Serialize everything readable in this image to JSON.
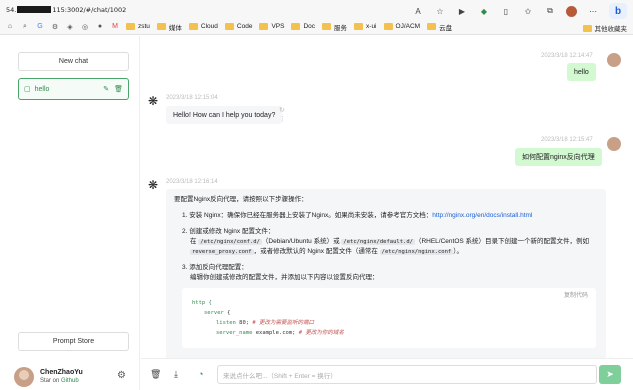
{
  "browser": {
    "url_prefix": "54.",
    "url_suffix": "115:3002/#/chat/1002",
    "bookmarks": [
      "zstu",
      "媒体",
      "Cloud",
      "Code",
      "VPS",
      "Doc",
      "服务",
      "x-ui",
      "OJ/ACM",
      "云盘"
    ],
    "other_bookmarks": "其他收藏夹"
  },
  "sidebar": {
    "new_chat": "New chat",
    "chat_items": [
      {
        "title": "hello"
      }
    ],
    "prompt_store": "Prompt Store",
    "user": {
      "name": "ChenZhaoYu",
      "sub_prefix": "Star on ",
      "sub_link": "Github"
    }
  },
  "messages": {
    "m1_time": "2023/3/18 12:14:47",
    "m1_text": "hello",
    "m2_time": "2023/3/18 12:15:04",
    "m2_text": "Hello! How can I help you today?",
    "m3_time": "2023/3/18 12:15:47",
    "m3_text": "如何配置nginx反向代理",
    "m4_time": "2023/3/18 12:16:14",
    "answer": {
      "intro": "要配置Nginx反向代理，请按照以下步骤操作：",
      "step1_a": "1. 安装 Nginx：确保你已经在服务器上安装了Nginx。如果尚未安装，请参考官方文档：",
      "step1_link": "http://nginx.org/en/docs/install.html",
      "step2_title": "2. 创建或修改 Nginx 配置文件：",
      "step2_a": "在 ",
      "step2_code1": "/etc/nginx/conf.d/",
      "step2_b": "（Debian/Ubuntu 系统）或 ",
      "step2_code2": "/etc/nginx/default.d/",
      "step2_c": "（RHEL/CentOS 系统）目录下创建一个新的配置文件，例如",
      "step2_code3": "reverse_proxy.conf",
      "step2_d": "，或者修改默认的 Nginx 配置文件（通常在 ",
      "step2_code4": "/etc/nginx/nginx.conf",
      "step2_e": "）。",
      "step3_title": "3. 添加反向代理配置：",
      "step3_a": "编辑你创建或修改的配置文件，并添加以下内容以设置反向代理：",
      "copy_code": "复制代码",
      "code_line1": "http {",
      "code_line2_kw": "server",
      "code_line2_rest": " {",
      "code_line3_kw": "listen",
      "code_line3_val": " 80;",
      "code_line3_cmt": " # 更改为需要监听的端口",
      "code_line4_kw": "server_name",
      "code_line4_val": " example.com;",
      "code_line4_cmt": " # 更改为你的域名"
    }
  },
  "input": {
    "placeholder": "来说点什么吧...（Shift + Enter = 换行）"
  }
}
